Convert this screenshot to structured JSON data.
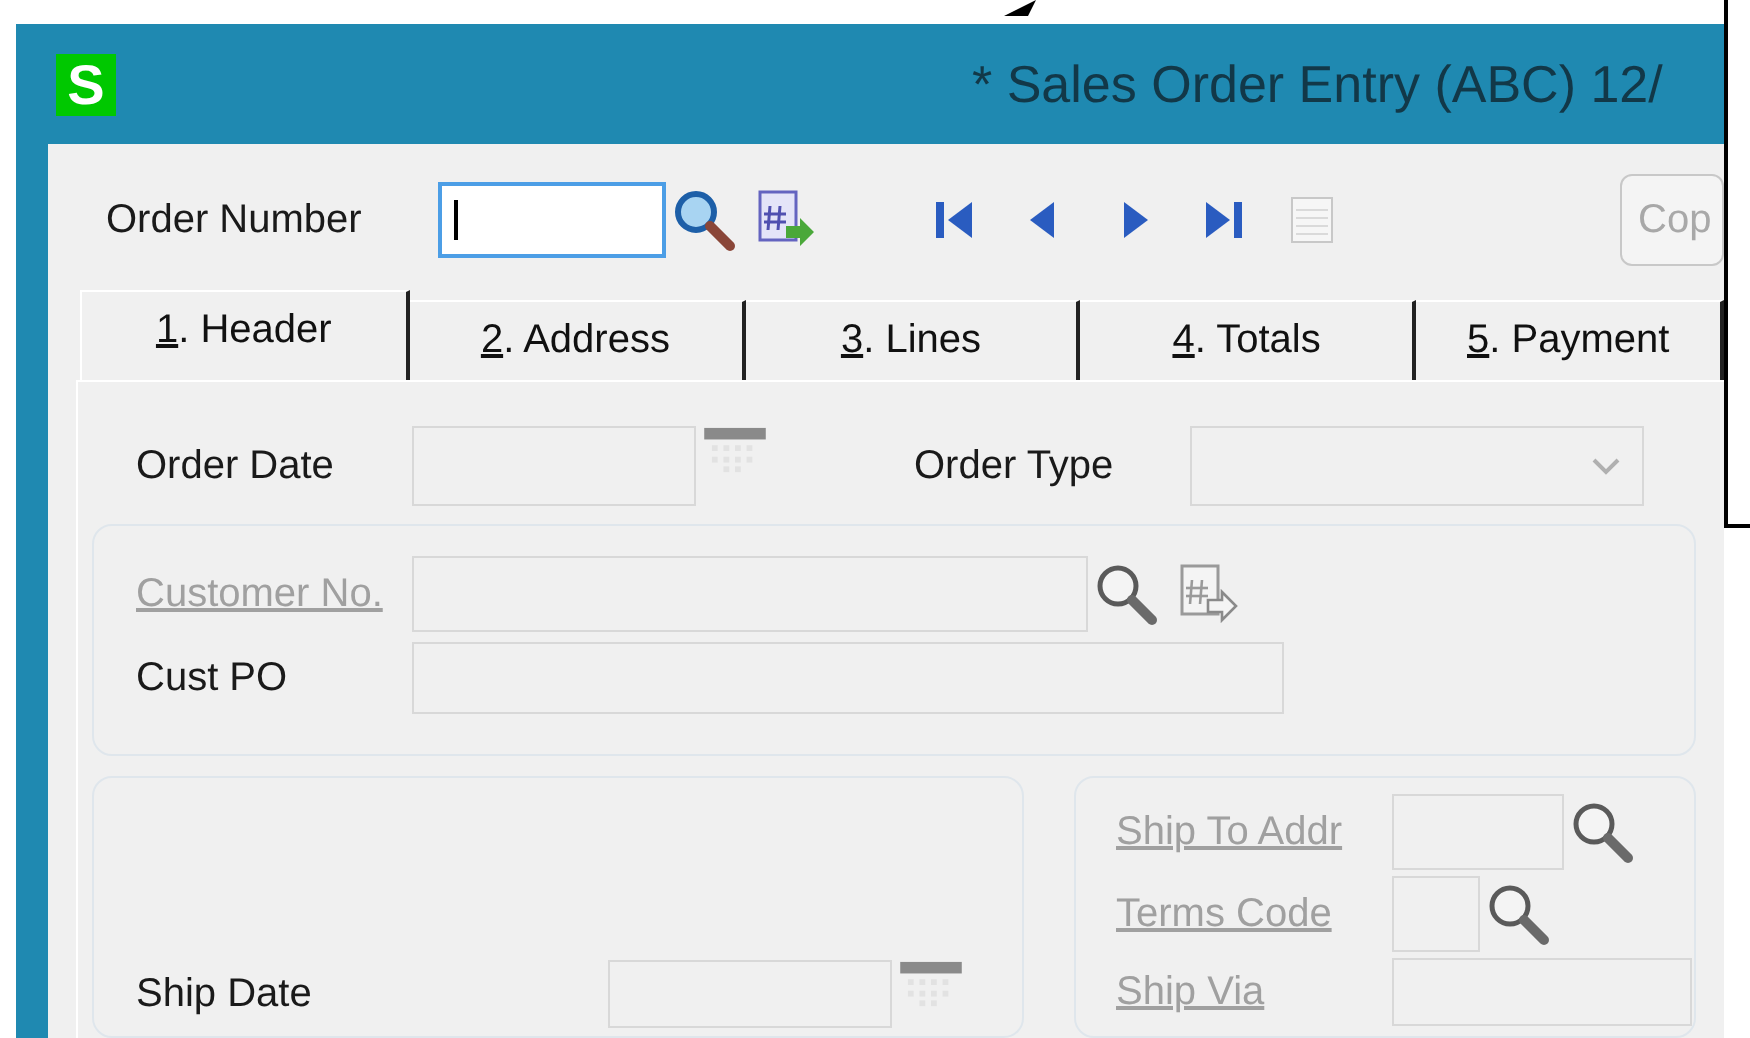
{
  "window": {
    "app_icon": "S",
    "title": "* Sales Order Entry (ABC) 12/"
  },
  "order_number": {
    "label": "Order Number",
    "focused": true
  },
  "copy_button": {
    "label": "Cop",
    "disabled": true
  },
  "tabs": [
    {
      "label": "1. Header",
      "selected": true
    },
    {
      "label": "2. Address",
      "selected": false
    },
    {
      "label": "3. Lines",
      "selected": false
    },
    {
      "label": "4. Totals",
      "selected": false
    },
    {
      "label": "5. Payment",
      "selected": false
    }
  ],
  "header_fields": [
    {
      "kind": "date",
      "label": "Order Date",
      "link": false,
      "disabled": false
    },
    {
      "kind": "dropdown",
      "label": "Order Type",
      "link": false,
      "disabled": false
    }
  ],
  "customer_group": [
    {
      "kind": "customer_lookup",
      "label": "Customer No.",
      "link": true,
      "disabled": true
    },
    {
      "kind": "text",
      "label": "Cust PO",
      "link": false,
      "disabled": false
    }
  ],
  "dates_group": [
    {
      "kind": "date",
      "label": "Ship Date",
      "link": false,
      "disabled": false
    }
  ],
  "shipping_group": [
    {
      "kind": "lookup",
      "label": "Ship To Addr",
      "link": true,
      "disabled": true
    },
    {
      "kind": "lookup",
      "label": "Terms Code",
      "link": true,
      "disabled": true
    },
    {
      "kind": "text",
      "label": "Ship Via",
      "link": true,
      "disabled": true
    }
  ]
}
